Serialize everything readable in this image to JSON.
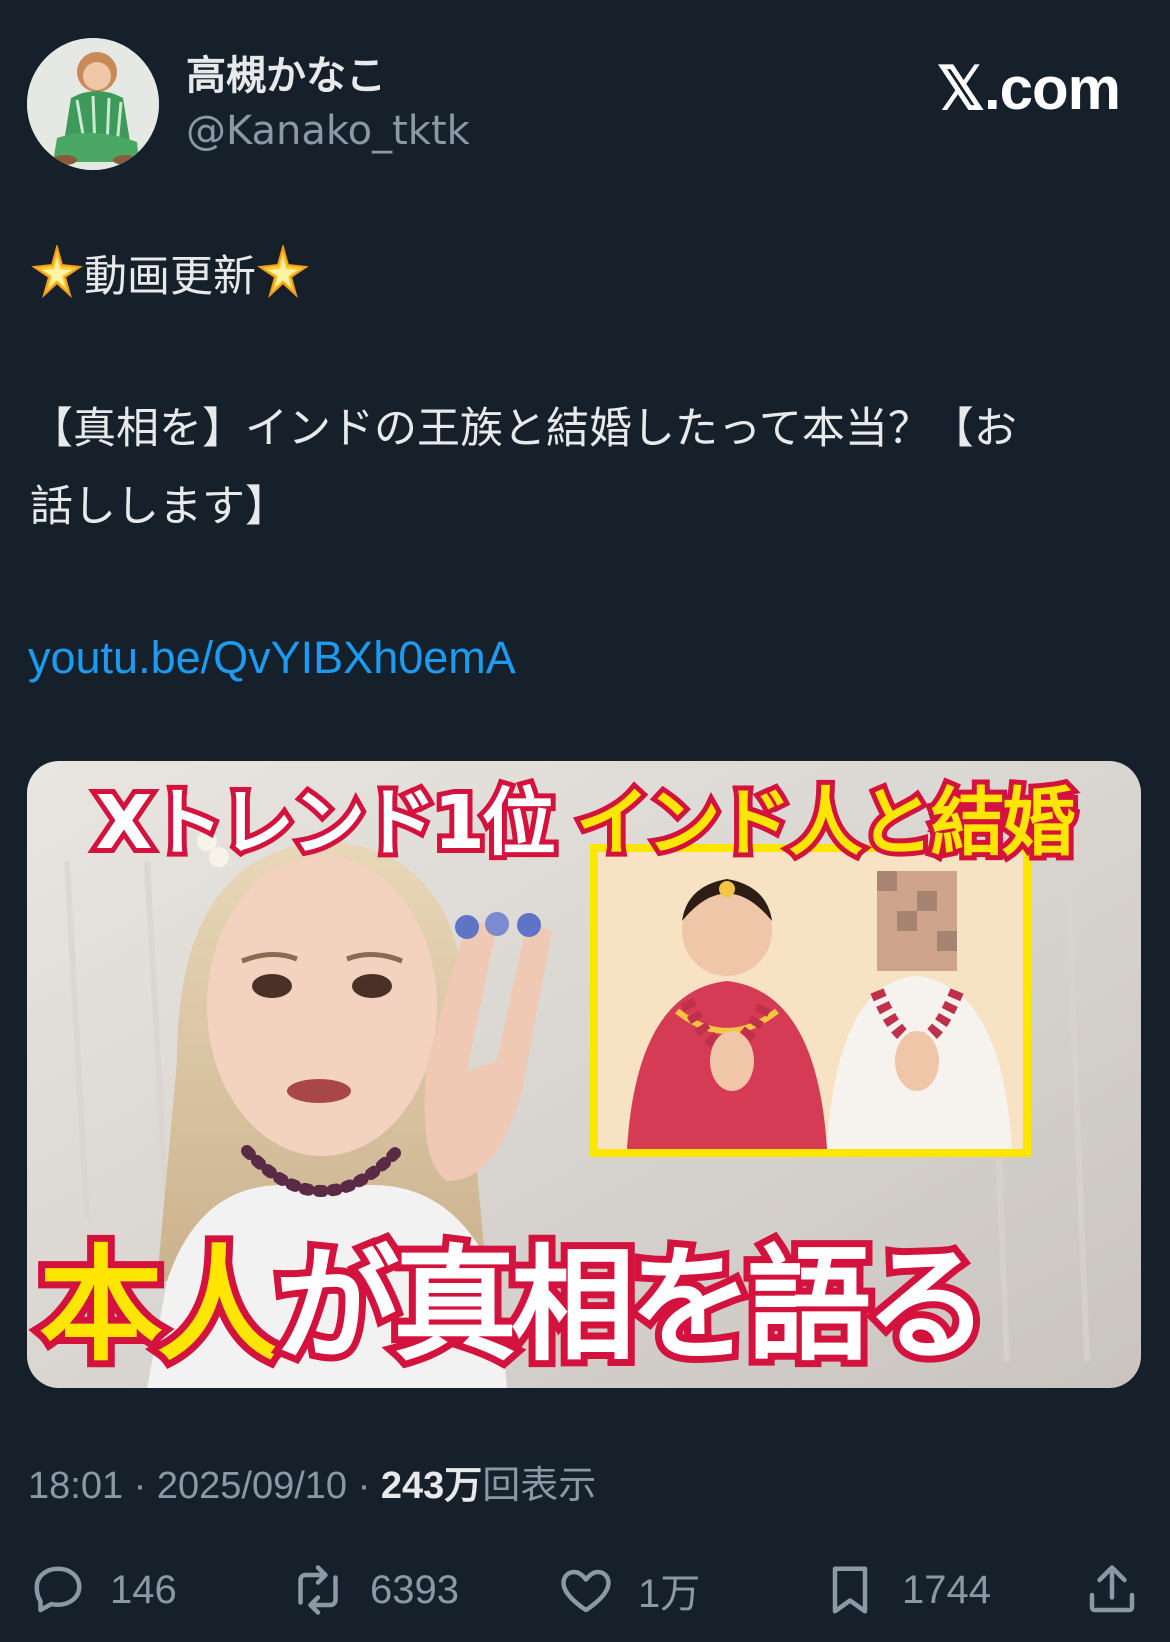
{
  "author": {
    "display_name": "高槻かなこ",
    "handle": "@Kanako_tktk"
  },
  "brand": "𝕏.com",
  "post": {
    "line1": "動画更新",
    "line2": "【真相を】インドの王族と結婚したって本当？【お",
    "line3": "話しします】",
    "link": "youtu.be/QvYIBXh0emA"
  },
  "thumbnail": {
    "top_white": "Xトレンド1位 ",
    "top_yellow": "インド人と結婚",
    "bottom_yellow": "本人",
    "bottom_white": "が真相を語る"
  },
  "meta": {
    "time": "18:01",
    "date": "2025/09/10",
    "sep": "·",
    "views_count": "243万",
    "views_label": "回表示"
  },
  "actions": {
    "replies": "146",
    "reposts": "6393",
    "likes": "1万",
    "bookmarks": "1744"
  },
  "icons": [
    "sparkle-icon",
    "reply-icon",
    "repost-icon",
    "like-icon",
    "bookmark-icon",
    "share-icon"
  ],
  "colors": {
    "background": "#15202b",
    "link": "#1d9bf0",
    "secondary_text": "#8b98a5",
    "thumbnail_accent": "#ffe600",
    "thumbnail_outline": "#d3123e"
  }
}
